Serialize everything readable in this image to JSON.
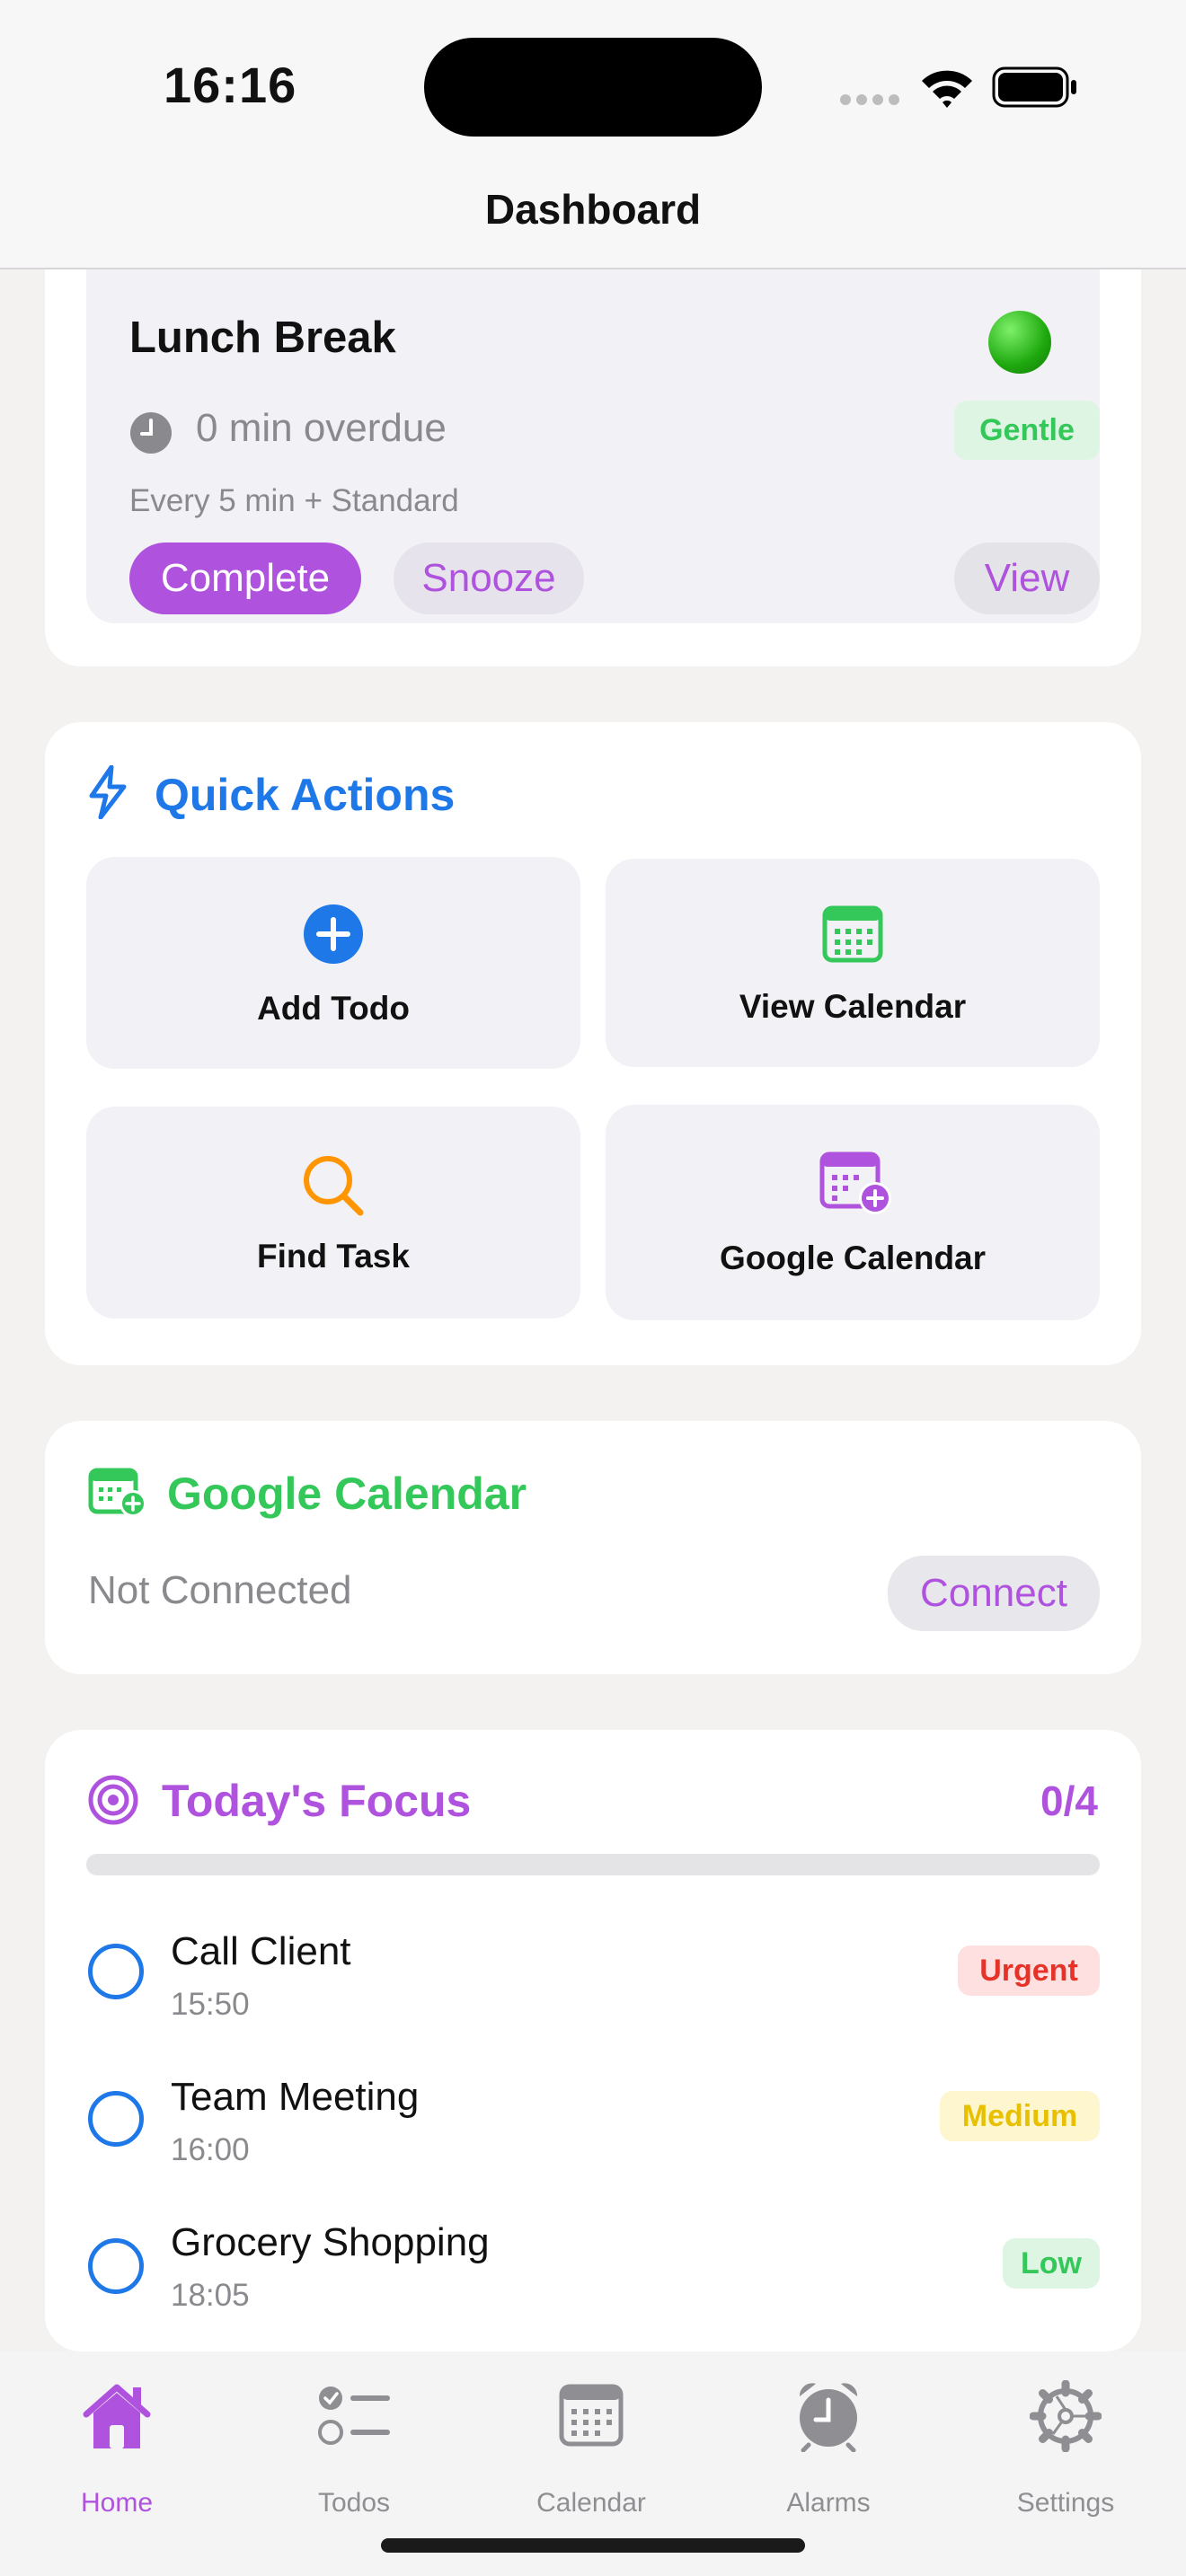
{
  "status_bar": {
    "time": "16:16"
  },
  "nav": {
    "title": "Dashboard"
  },
  "alarm_card": {
    "title": "Lunch Break",
    "overdue": "0 min overdue",
    "tone_badge": "Gentle",
    "schedule": "Every 5 min + Standard",
    "complete_label": "Complete",
    "snooze_label": "Snooze",
    "view_label": "View",
    "status_color": "#22b614"
  },
  "quick_actions": {
    "title": "Quick Actions",
    "items": [
      {
        "label": "Add Todo",
        "icon": "plus-circle-icon"
      },
      {
        "label": "View Calendar",
        "icon": "calendar-icon"
      },
      {
        "label": "Find Task",
        "icon": "search-icon"
      },
      {
        "label": "Google Calendar",
        "icon": "calendar-add-icon"
      }
    ]
  },
  "google_calendar": {
    "title": "Google Calendar",
    "status": "Not Connected",
    "connect_label": "Connect"
  },
  "focus": {
    "title": "Today's Focus",
    "count": "0/4",
    "progress": 0,
    "todos": [
      {
        "title": "Call Client",
        "time": "15:50",
        "priority": "Urgent"
      },
      {
        "title": "Team Meeting",
        "time": "16:00",
        "priority": "Medium"
      },
      {
        "title": "Grocery Shopping",
        "time": "18:05",
        "priority": "Low"
      }
    ]
  },
  "tabs": [
    {
      "label": "Home",
      "icon": "house-icon",
      "active": true
    },
    {
      "label": "Todos",
      "icon": "checklist-icon",
      "active": false
    },
    {
      "label": "Calendar",
      "icon": "calendar-icon",
      "active": false
    },
    {
      "label": "Alarms",
      "icon": "alarm-clock-icon",
      "active": false
    },
    {
      "label": "Settings",
      "icon": "gear-icon",
      "active": false
    }
  ],
  "colors": {
    "purple": "#af52de",
    "blue": "#1e78e8",
    "green": "#34c759",
    "orange": "#ff9500",
    "urgent_bg": "#fde0df",
    "urgent_fg": "#e5332a",
    "medium_bg": "#fdf6cf",
    "medium_fg": "#e8c000",
    "low_bg": "#dff5e4",
    "low_fg": "#34c759"
  }
}
